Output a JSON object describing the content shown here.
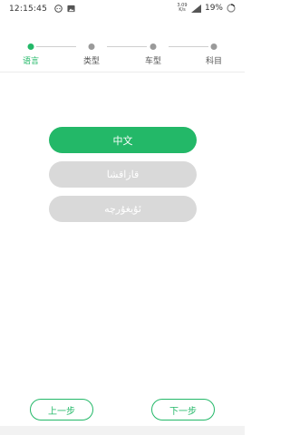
{
  "status_bar": {
    "time": "12:15:45",
    "network_speed_top": "3.09",
    "network_speed_bottom": "K/s",
    "signal": "4G",
    "battery": "19%"
  },
  "stepper": {
    "steps": [
      {
        "label": "语言",
        "active": true
      },
      {
        "label": "类型",
        "active": false
      },
      {
        "label": "车型",
        "active": false
      },
      {
        "label": "科目",
        "active": false
      }
    ]
  },
  "languages": [
    {
      "label": "中文",
      "selected": true
    },
    {
      "label": "قازاقشا",
      "selected": false
    },
    {
      "label": "ئۇيغۇرچە",
      "selected": false
    }
  ],
  "nav": {
    "prev_label": "上一步",
    "next_label": "下一步"
  },
  "colors": {
    "accent": "#23b868",
    "inactive_button": "#d9d9d9",
    "inactive_dot": "#9a9a9a"
  }
}
